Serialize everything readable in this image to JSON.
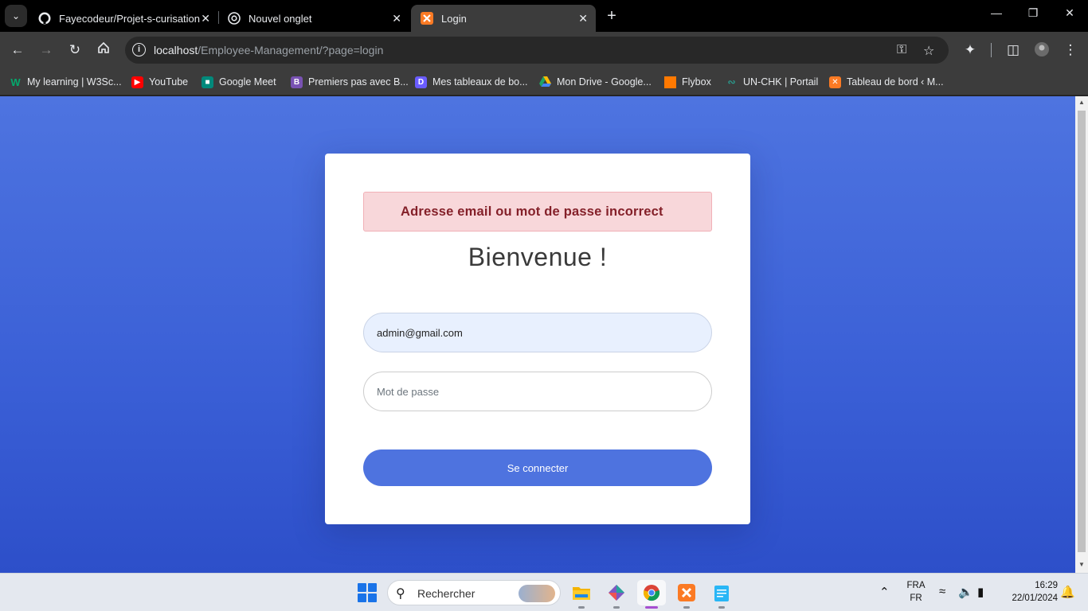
{
  "browser": {
    "tabs": [
      {
        "title": "Fayecodeur/Projet-s-curisation",
        "icon": "github-icon",
        "active": false
      },
      {
        "title": "Nouvel onglet",
        "icon": "chrome-icon",
        "active": false
      },
      {
        "title": "Login",
        "icon": "xampp-icon",
        "active": true
      }
    ],
    "url": {
      "host": "localhost",
      "path": "/Employee-Management/?page=login"
    },
    "bookmarks": [
      {
        "label": "My learning | W3Sc...",
        "icon": "w3schools-icon",
        "color": "#04aa6d"
      },
      {
        "label": "YouTube",
        "icon": "youtube-icon",
        "color": "#ff0000"
      },
      {
        "label": "Google Meet",
        "icon": "meet-icon",
        "color": "#00897b"
      },
      {
        "label": "Premiers pas avec B...",
        "icon": "bootstrap-icon",
        "color": "#7952b3"
      },
      {
        "label": "Mes tableaux de bo...",
        "icon": "dashboard-icon",
        "color": "#6a5cff"
      },
      {
        "label": "Mon Drive - Google...",
        "icon": "drive-icon",
        "color": "#fbbc04"
      },
      {
        "label": "Flybox",
        "icon": "orange-icon",
        "color": "#ff7900"
      },
      {
        "label": "UN-CHK | Portail",
        "icon": "unchk-icon",
        "color": "#2a9d8f"
      },
      {
        "label": "Tableau de bord ‹ M...",
        "icon": "xampp-icon",
        "color": "#fb7a24"
      }
    ]
  },
  "login": {
    "alert": "Adresse email ou mot de passe incorrect",
    "title": "Bienvenue !",
    "email_value": "admin@gmail.com",
    "password_placeholder": "Mot de passe",
    "submit_label": "Se connecter"
  },
  "taskbar": {
    "search_label": "Rechercher",
    "lang_top": "FRA",
    "lang_bottom": "FR",
    "time": "16:29",
    "date": "22/01/2024"
  },
  "colors": {
    "page_gradient_top": "#4e74e0",
    "button": "#4e73df",
    "alert_bg": "#f8d7da",
    "alert_text": "#842029"
  }
}
